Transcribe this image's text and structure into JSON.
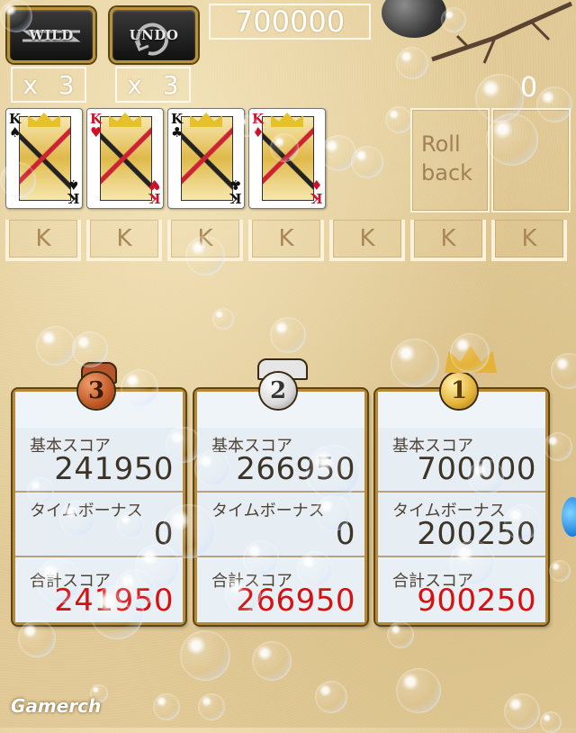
{
  "toolbar": {
    "wild_label": "WILD",
    "undo_label": "UNDO",
    "wild_count_x": "x",
    "wild_count": "3",
    "undo_count_x": "x",
    "undo_count": "3",
    "score": "700000",
    "side_count": "0"
  },
  "cards": [
    {
      "rank": "K",
      "suit": "♠",
      "color": "#111111"
    },
    {
      "rank": "K",
      "suit": "♥",
      "color": "#d0102a"
    },
    {
      "rank": "K",
      "suit": "♣",
      "color": "#111111"
    },
    {
      "rank": "K",
      "suit": "♦",
      "color": "#d0102a"
    }
  ],
  "rollback": {
    "line1": "Roll",
    "line2": "back"
  },
  "slots": [
    "K",
    "K",
    "K",
    "K",
    "K",
    "K",
    "K"
  ],
  "results": [
    {
      "rank": "3",
      "base_label": "基本スコア",
      "base": "241950",
      "bonus_label": "タイムボーナス",
      "bonus": "0",
      "total_label": "合計スコア",
      "total": "241950"
    },
    {
      "rank": "2",
      "base_label": "基本スコア",
      "base": "266950",
      "bonus_label": "タイムボーナス",
      "bonus": "0",
      "total_label": "合計スコア",
      "total": "266950"
    },
    {
      "rank": "1",
      "base_label": "基本スコア",
      "base": "700000",
      "bonus_label": "タイムボーナス",
      "bonus": "200250",
      "total_label": "合計スコア",
      "total": "900250"
    }
  ],
  "watermark": "Gamerch",
  "colors": {
    "gold_frame": "#b78a3a",
    "total_red": "#d81010",
    "sand": "#e2cb98"
  }
}
